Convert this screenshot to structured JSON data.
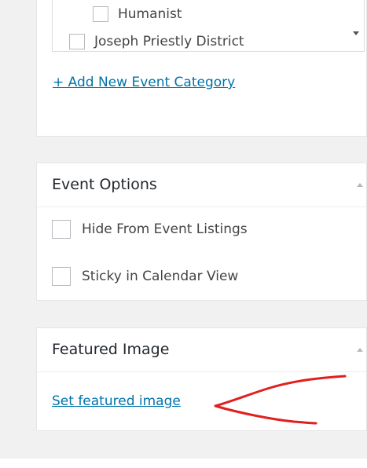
{
  "categories": {
    "items": [
      {
        "label": "Humanist"
      },
      {
        "label": "Joseph Priestly District"
      }
    ],
    "add_link": "+ Add New Event Category"
  },
  "event_options": {
    "title": "Event Options",
    "options": [
      {
        "label": "Hide From Event Listings"
      },
      {
        "label": "Sticky in Calendar View"
      }
    ]
  },
  "featured_image": {
    "title": "Featured Image",
    "link": "Set featured image"
  },
  "annotation": {
    "color": "#e02020",
    "shape": "red arrow pointing to link"
  }
}
